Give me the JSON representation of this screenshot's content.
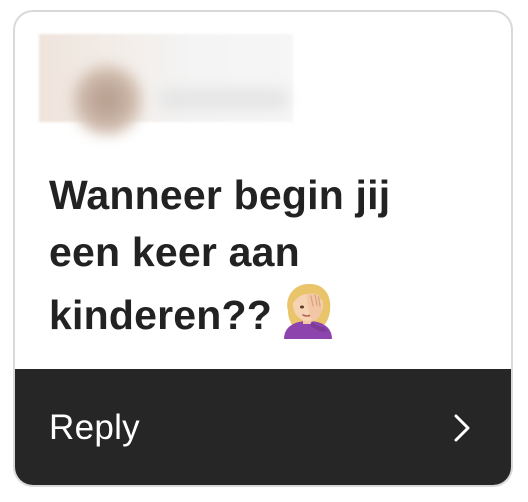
{
  "story_reply": {
    "header": {
      "avatar_icon": "blurred-avatar",
      "name_state": "blurred"
    },
    "message": {
      "line1": "Wanneer begin jij",
      "line2": "een keer aan",
      "line3": "kinderen??",
      "emoji_icon": "woman-facepalming-emoji"
    },
    "reply": {
      "label": "Reply",
      "icon": "chevron-right-icon"
    },
    "colors": {
      "card_border": "#d9d9d9",
      "text": "#222222",
      "reply_bar_bg": "#262626",
      "reply_text": "#ffffff"
    }
  }
}
